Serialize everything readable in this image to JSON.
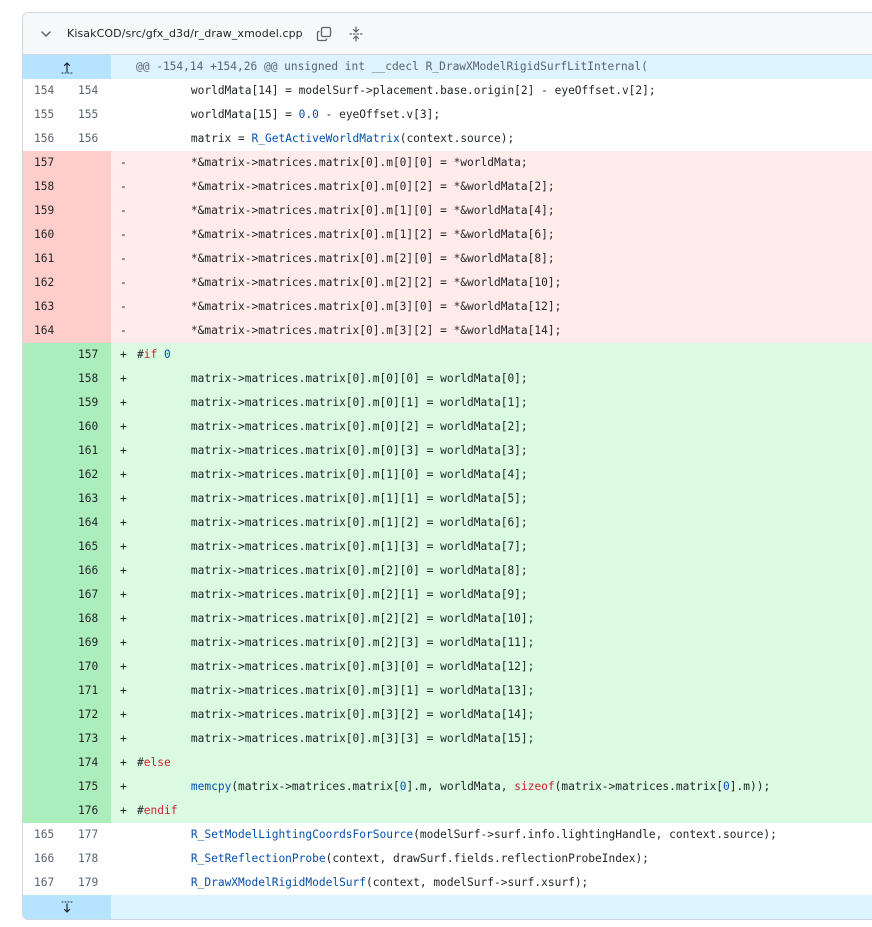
{
  "file": {
    "path": "KisakCOD/src/gfx_d3d/r_draw_xmodel.cpp",
    "icons": {
      "collapse": "chevron-down-icon",
      "copy": "copy-icon",
      "expand_all": "unfold-icon"
    }
  },
  "colors": {
    "deletion_gutter": "#ffcecb",
    "deletion_line": "#ffebe9",
    "addition_gutter": "#aceebb",
    "addition_line": "#dafbe1",
    "hunk_gutter": "#b6e3ff",
    "hunk_line": "#ddf4ff",
    "function": "#0550ae",
    "keyword": "#cf222e"
  },
  "hunk_header": "@@ -154,14 +154,26 @@ unsigned int __cdecl R_DrawXModelRigidSurfLitInternal(",
  "lines": [
    {
      "type": "ctx",
      "old": "154",
      "new": "154",
      "marker": " ",
      "segments": [
        {
          "t": "        worldMata[14] = modelSurf->placement.base.origin[2] - eyeOffset.v[2];"
        }
      ]
    },
    {
      "type": "ctx",
      "old": "155",
      "new": "155",
      "marker": " ",
      "segments": [
        {
          "t": "        worldMata[15] = "
        },
        {
          "t": "0.0",
          "c": "cnum"
        },
        {
          "t": " - eyeOffset.v[3];"
        }
      ]
    },
    {
      "type": "ctx",
      "old": "156",
      "new": "156",
      "marker": " ",
      "segments": [
        {
          "t": "        matrix = "
        },
        {
          "t": "R_GetActiveWorldMatrix",
          "c": "fn"
        },
        {
          "t": "(context.source);"
        }
      ]
    },
    {
      "type": "del",
      "old": "157",
      "new": "",
      "marker": "-",
      "segments": [
        {
          "t": "        *&matrix->matrices.matrix[0].m[0][0] = *worldMata;"
        }
      ]
    },
    {
      "type": "del",
      "old": "158",
      "new": "",
      "marker": "-",
      "segments": [
        {
          "t": "        *&matrix->matrices.matrix[0].m[0][2] = *&worldMata[2];"
        }
      ]
    },
    {
      "type": "del",
      "old": "159",
      "new": "",
      "marker": "-",
      "segments": [
        {
          "t": "        *&matrix->matrices.matrix[0].m[1][0] = *&worldMata[4];"
        }
      ]
    },
    {
      "type": "del",
      "old": "160",
      "new": "",
      "marker": "-",
      "segments": [
        {
          "t": "        *&matrix->matrices.matrix[0].m[1][2] = *&worldMata[6];"
        }
      ]
    },
    {
      "type": "del",
      "old": "161",
      "new": "",
      "marker": "-",
      "segments": [
        {
          "t": "        *&matrix->matrices.matrix[0].m[2][0] = *&worldMata[8];"
        }
      ]
    },
    {
      "type": "del",
      "old": "162",
      "new": "",
      "marker": "-",
      "segments": [
        {
          "t": "        *&matrix->matrices.matrix[0].m[2][2] = *&worldMata[10];"
        }
      ]
    },
    {
      "type": "del",
      "old": "163",
      "new": "",
      "marker": "-",
      "segments": [
        {
          "t": "        *&matrix->matrices.matrix[0].m[3][0] = *&worldMata[12];"
        }
      ]
    },
    {
      "type": "del",
      "old": "164",
      "new": "",
      "marker": "-",
      "segments": [
        {
          "t": "        *&matrix->matrices.matrix[0].m[3][2] = *&worldMata[14];"
        }
      ]
    },
    {
      "type": "add",
      "old": "",
      "new": "157",
      "marker": "+",
      "segments": [
        {
          "t": "#"
        },
        {
          "t": "if",
          "c": "kw"
        },
        {
          "t": " "
        },
        {
          "t": "0",
          "c": "cnum"
        }
      ]
    },
    {
      "type": "add",
      "old": "",
      "new": "158",
      "marker": "+",
      "segments": [
        {
          "t": "        matrix->matrices.matrix[0].m[0][0] = worldMata[0];"
        }
      ]
    },
    {
      "type": "add",
      "old": "",
      "new": "159",
      "marker": "+",
      "segments": [
        {
          "t": "        matrix->matrices.matrix[0].m[0][1] = worldMata[1];"
        }
      ]
    },
    {
      "type": "add",
      "old": "",
      "new": "160",
      "marker": "+",
      "segments": [
        {
          "t": "        matrix->matrices.matrix[0].m[0][2] = worldMata[2];"
        }
      ]
    },
    {
      "type": "add",
      "old": "",
      "new": "161",
      "marker": "+",
      "segments": [
        {
          "t": "        matrix->matrices.matrix[0].m[0][3] = worldMata[3];"
        }
      ]
    },
    {
      "type": "add",
      "old": "",
      "new": "162",
      "marker": "+",
      "segments": [
        {
          "t": "        matrix->matrices.matrix[0].m[1][0] = worldMata[4];"
        }
      ]
    },
    {
      "type": "add",
      "old": "",
      "new": "163",
      "marker": "+",
      "segments": [
        {
          "t": "        matrix->matrices.matrix[0].m[1][1] = worldMata[5];"
        }
      ]
    },
    {
      "type": "add",
      "old": "",
      "new": "164",
      "marker": "+",
      "segments": [
        {
          "t": "        matrix->matrices.matrix[0].m[1][2] = worldMata[6];"
        }
      ]
    },
    {
      "type": "add",
      "old": "",
      "new": "165",
      "marker": "+",
      "segments": [
        {
          "t": "        matrix->matrices.matrix[0].m[1][3] = worldMata[7];"
        }
      ]
    },
    {
      "type": "add",
      "old": "",
      "new": "166",
      "marker": "+",
      "segments": [
        {
          "t": "        matrix->matrices.matrix[0].m[2][0] = worldMata[8];"
        }
      ]
    },
    {
      "type": "add",
      "old": "",
      "new": "167",
      "marker": "+",
      "segments": [
        {
          "t": "        matrix->matrices.matrix[0].m[2][1] = worldMata[9];"
        }
      ]
    },
    {
      "type": "add",
      "old": "",
      "new": "168",
      "marker": "+",
      "segments": [
        {
          "t": "        matrix->matrices.matrix[0].m[2][2] = worldMata[10];"
        }
      ]
    },
    {
      "type": "add",
      "old": "",
      "new": "169",
      "marker": "+",
      "segments": [
        {
          "t": "        matrix->matrices.matrix[0].m[2][3] = worldMata[11];"
        }
      ]
    },
    {
      "type": "add",
      "old": "",
      "new": "170",
      "marker": "+",
      "segments": [
        {
          "t": "        matrix->matrices.matrix[0].m[3][0] = worldMata[12];"
        }
      ]
    },
    {
      "type": "add",
      "old": "",
      "new": "171",
      "marker": "+",
      "segments": [
        {
          "t": "        matrix->matrices.matrix[0].m[3][1] = worldMata[13];"
        }
      ]
    },
    {
      "type": "add",
      "old": "",
      "new": "172",
      "marker": "+",
      "segments": [
        {
          "t": "        matrix->matrices.matrix[0].m[3][2] = worldMata[14];"
        }
      ]
    },
    {
      "type": "add",
      "old": "",
      "new": "173",
      "marker": "+",
      "segments": [
        {
          "t": "        matrix->matrices.matrix[0].m[3][3] = worldMata[15];"
        }
      ]
    },
    {
      "type": "add",
      "old": "",
      "new": "174",
      "marker": "+",
      "segments": [
        {
          "t": "#"
        },
        {
          "t": "else",
          "c": "kw"
        }
      ]
    },
    {
      "type": "add",
      "old": "",
      "new": "175",
      "marker": "+",
      "segments": [
        {
          "t": "        "
        },
        {
          "t": "memcpy",
          "c": "fn"
        },
        {
          "t": "(matrix->matrices.matrix["
        },
        {
          "t": "0",
          "c": "cnum"
        },
        {
          "t": "].m, worldMata, "
        },
        {
          "t": "sizeof",
          "c": "kw"
        },
        {
          "t": "(matrix->matrices.matrix["
        },
        {
          "t": "0",
          "c": "cnum"
        },
        {
          "t": "].m));"
        }
      ]
    },
    {
      "type": "add",
      "old": "",
      "new": "176",
      "marker": "+",
      "segments": [
        {
          "t": "#"
        },
        {
          "t": "endif",
          "c": "kw"
        }
      ]
    },
    {
      "type": "ctx",
      "old": "165",
      "new": "177",
      "marker": " ",
      "segments": [
        {
          "t": "        "
        },
        {
          "t": "R_SetModelLightingCoordsForSource",
          "c": "fn"
        },
        {
          "t": "(modelSurf->surf.info.lightingHandle, context.source);"
        }
      ]
    },
    {
      "type": "ctx",
      "old": "166",
      "new": "178",
      "marker": " ",
      "segments": [
        {
          "t": "        "
        },
        {
          "t": "R_SetReflectionProbe",
          "c": "fn"
        },
        {
          "t": "(context, drawSurf.fields.reflectionProbeIndex);"
        }
      ]
    },
    {
      "type": "ctx",
      "old": "167",
      "new": "179",
      "marker": " ",
      "segments": [
        {
          "t": "        "
        },
        {
          "t": "R_DrawXModelRigidModelSurf",
          "c": "fn"
        },
        {
          "t": "(context, modelSurf->surf.xsurf);"
        }
      ]
    }
  ]
}
